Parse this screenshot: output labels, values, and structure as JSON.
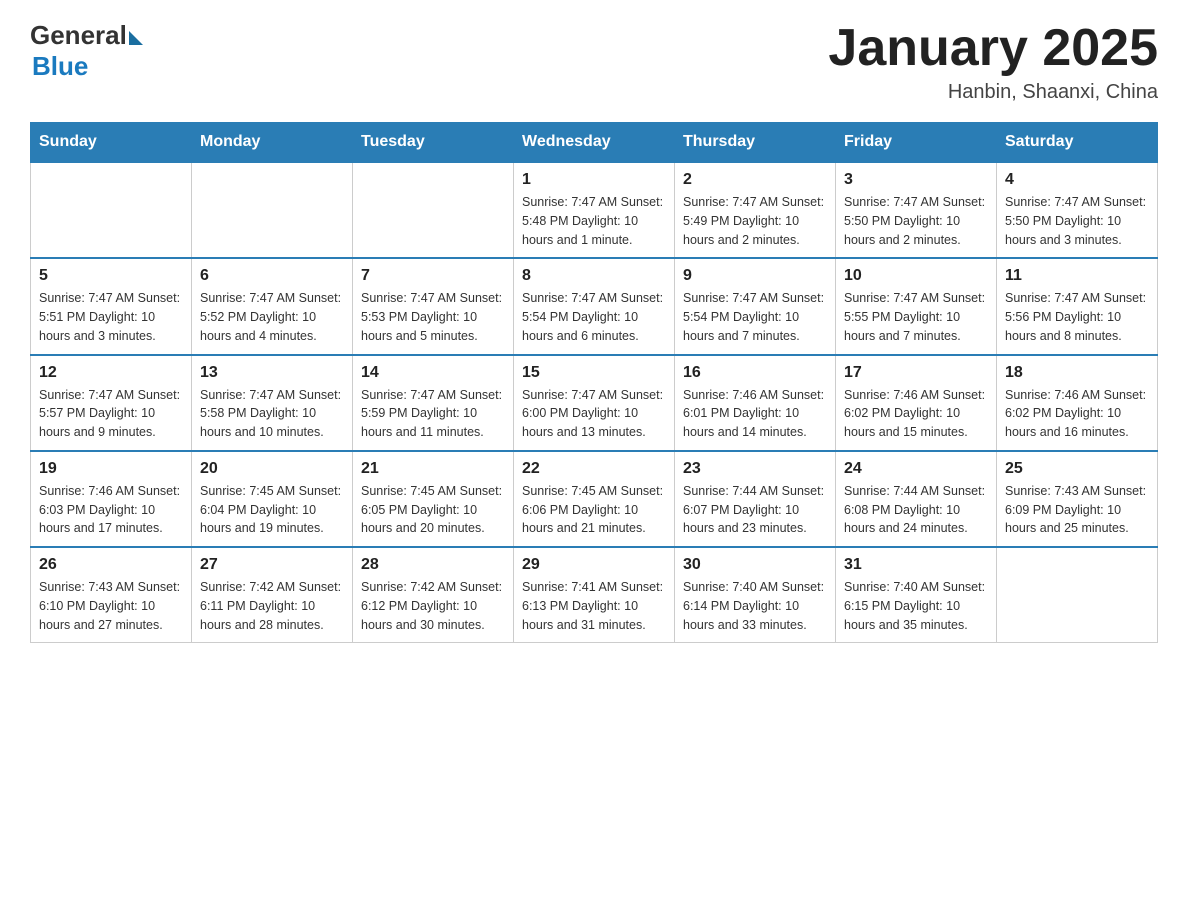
{
  "header": {
    "logo_general": "General",
    "logo_blue": "Blue",
    "month_title": "January 2025",
    "location": "Hanbin, Shaanxi, China"
  },
  "days_of_week": [
    "Sunday",
    "Monday",
    "Tuesday",
    "Wednesday",
    "Thursday",
    "Friday",
    "Saturday"
  ],
  "weeks": [
    [
      {
        "day": "",
        "info": ""
      },
      {
        "day": "",
        "info": ""
      },
      {
        "day": "",
        "info": ""
      },
      {
        "day": "1",
        "info": "Sunrise: 7:47 AM\nSunset: 5:48 PM\nDaylight: 10 hours and 1 minute."
      },
      {
        "day": "2",
        "info": "Sunrise: 7:47 AM\nSunset: 5:49 PM\nDaylight: 10 hours and 2 minutes."
      },
      {
        "day": "3",
        "info": "Sunrise: 7:47 AM\nSunset: 5:50 PM\nDaylight: 10 hours and 2 minutes."
      },
      {
        "day": "4",
        "info": "Sunrise: 7:47 AM\nSunset: 5:50 PM\nDaylight: 10 hours and 3 minutes."
      }
    ],
    [
      {
        "day": "5",
        "info": "Sunrise: 7:47 AM\nSunset: 5:51 PM\nDaylight: 10 hours and 3 minutes."
      },
      {
        "day": "6",
        "info": "Sunrise: 7:47 AM\nSunset: 5:52 PM\nDaylight: 10 hours and 4 minutes."
      },
      {
        "day": "7",
        "info": "Sunrise: 7:47 AM\nSunset: 5:53 PM\nDaylight: 10 hours and 5 minutes."
      },
      {
        "day": "8",
        "info": "Sunrise: 7:47 AM\nSunset: 5:54 PM\nDaylight: 10 hours and 6 minutes."
      },
      {
        "day": "9",
        "info": "Sunrise: 7:47 AM\nSunset: 5:54 PM\nDaylight: 10 hours and 7 minutes."
      },
      {
        "day": "10",
        "info": "Sunrise: 7:47 AM\nSunset: 5:55 PM\nDaylight: 10 hours and 7 minutes."
      },
      {
        "day": "11",
        "info": "Sunrise: 7:47 AM\nSunset: 5:56 PM\nDaylight: 10 hours and 8 minutes."
      }
    ],
    [
      {
        "day": "12",
        "info": "Sunrise: 7:47 AM\nSunset: 5:57 PM\nDaylight: 10 hours and 9 minutes."
      },
      {
        "day": "13",
        "info": "Sunrise: 7:47 AM\nSunset: 5:58 PM\nDaylight: 10 hours and 10 minutes."
      },
      {
        "day": "14",
        "info": "Sunrise: 7:47 AM\nSunset: 5:59 PM\nDaylight: 10 hours and 11 minutes."
      },
      {
        "day": "15",
        "info": "Sunrise: 7:47 AM\nSunset: 6:00 PM\nDaylight: 10 hours and 13 minutes."
      },
      {
        "day": "16",
        "info": "Sunrise: 7:46 AM\nSunset: 6:01 PM\nDaylight: 10 hours and 14 minutes."
      },
      {
        "day": "17",
        "info": "Sunrise: 7:46 AM\nSunset: 6:02 PM\nDaylight: 10 hours and 15 minutes."
      },
      {
        "day": "18",
        "info": "Sunrise: 7:46 AM\nSunset: 6:02 PM\nDaylight: 10 hours and 16 minutes."
      }
    ],
    [
      {
        "day": "19",
        "info": "Sunrise: 7:46 AM\nSunset: 6:03 PM\nDaylight: 10 hours and 17 minutes."
      },
      {
        "day": "20",
        "info": "Sunrise: 7:45 AM\nSunset: 6:04 PM\nDaylight: 10 hours and 19 minutes."
      },
      {
        "day": "21",
        "info": "Sunrise: 7:45 AM\nSunset: 6:05 PM\nDaylight: 10 hours and 20 minutes."
      },
      {
        "day": "22",
        "info": "Sunrise: 7:45 AM\nSunset: 6:06 PM\nDaylight: 10 hours and 21 minutes."
      },
      {
        "day": "23",
        "info": "Sunrise: 7:44 AM\nSunset: 6:07 PM\nDaylight: 10 hours and 23 minutes."
      },
      {
        "day": "24",
        "info": "Sunrise: 7:44 AM\nSunset: 6:08 PM\nDaylight: 10 hours and 24 minutes."
      },
      {
        "day": "25",
        "info": "Sunrise: 7:43 AM\nSunset: 6:09 PM\nDaylight: 10 hours and 25 minutes."
      }
    ],
    [
      {
        "day": "26",
        "info": "Sunrise: 7:43 AM\nSunset: 6:10 PM\nDaylight: 10 hours and 27 minutes."
      },
      {
        "day": "27",
        "info": "Sunrise: 7:42 AM\nSunset: 6:11 PM\nDaylight: 10 hours and 28 minutes."
      },
      {
        "day": "28",
        "info": "Sunrise: 7:42 AM\nSunset: 6:12 PM\nDaylight: 10 hours and 30 minutes."
      },
      {
        "day": "29",
        "info": "Sunrise: 7:41 AM\nSunset: 6:13 PM\nDaylight: 10 hours and 31 minutes."
      },
      {
        "day": "30",
        "info": "Sunrise: 7:40 AM\nSunset: 6:14 PM\nDaylight: 10 hours and 33 minutes."
      },
      {
        "day": "31",
        "info": "Sunrise: 7:40 AM\nSunset: 6:15 PM\nDaylight: 10 hours and 35 minutes."
      },
      {
        "day": "",
        "info": ""
      }
    ]
  ]
}
